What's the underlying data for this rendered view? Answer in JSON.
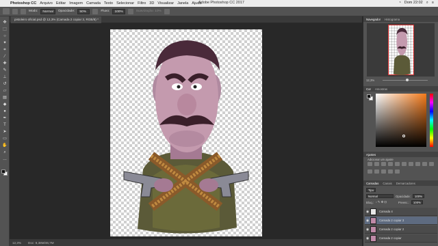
{
  "menubar": {
    "app": "Photoshop CC",
    "items": [
      "Arquivo",
      "Editar",
      "Imagem",
      "Camada",
      "Texto",
      "Selecionar",
      "Filtro",
      "3D",
      "Visualizar",
      "Janela",
      "Ajuda"
    ],
    "window_title": "Adobe Photoshop CC 2017",
    "clock": "Dom 22:02"
  },
  "options": {
    "size_label": "Modo:",
    "mode_value": "Normal",
    "opacity_label": "Opacidade:",
    "opacity_value": "50%",
    "flow_label": "Fluxo:",
    "flow_value": "100%",
    "smoothing_label": "Suavização: 10%"
  },
  "document": {
    "tab_title": "pistoleiro oficial.psd @ 12,3% (Camada 2 copiar 3, RGB/8) *",
    "zoom": "12,3%",
    "doc_info": "Doc: 8,38M/46,7M"
  },
  "panels": {
    "navigator_tabs": [
      "Navegador",
      "Histograma"
    ],
    "navigator_zoom": "12,3%",
    "color_tabs": [
      "Cor",
      "Amostras"
    ],
    "adjust_title": "Ajustes",
    "adjust_hint": "Adicionar um ajuste",
    "layers_tabs": [
      "Camadas",
      "Canais",
      "Demarcadores"
    ],
    "kind_label": "Tipo",
    "blend_mode": "Normal",
    "opacity_label": "Opacidade:",
    "opacity_value": "100%",
    "lock_label": "Bloq.:",
    "fill_label": "Preenc.:",
    "fill_value": "100%",
    "layers": [
      {
        "name": "Camada 4"
      },
      {
        "name": "Camada 2 copiar 3"
      },
      {
        "name": "Camada 2 copiar 2"
      },
      {
        "name": "Camada 2 copiar"
      }
    ]
  },
  "colors": {
    "accent": "#f47a1a",
    "selection": "#5e6b80"
  }
}
